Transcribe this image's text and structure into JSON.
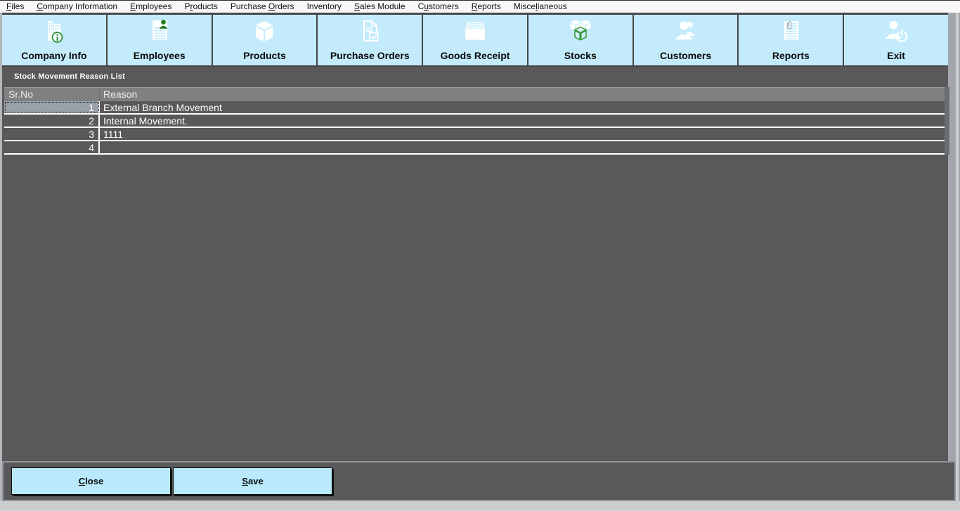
{
  "menu": {
    "items": [
      {
        "label": "Files",
        "underline": 0
      },
      {
        "label": "Company Information",
        "underline": 0
      },
      {
        "label": "Employees",
        "underline": 0
      },
      {
        "label": "Products",
        "underline": 1
      },
      {
        "label": "Purchase Orders",
        "underline": 9
      },
      {
        "label": "Inventory",
        "underline": -1
      },
      {
        "label": "Sales Module",
        "underline": 0
      },
      {
        "label": "Customers",
        "underline": 1
      },
      {
        "label": "Reports",
        "underline": 0
      },
      {
        "label": "Miscellaneous",
        "underline": 5
      }
    ]
  },
  "toolbar": {
    "items": [
      {
        "label": "Company Info",
        "icon": "building-info-icon"
      },
      {
        "label": "Employees",
        "icon": "employee-card-icon"
      },
      {
        "label": "Products",
        "icon": "cube-icon"
      },
      {
        "label": "Purchase Orders",
        "icon": "document-check-icon"
      },
      {
        "label": "Goods Receipt",
        "icon": "goods-box-icon"
      },
      {
        "label": "Stocks",
        "icon": "stacked-cubes-icon"
      },
      {
        "label": "Customers",
        "icon": "people-icon"
      },
      {
        "label": "Reports",
        "icon": "report-document-icon"
      },
      {
        "label": "Exit",
        "icon": "person-power-icon"
      }
    ]
  },
  "panel": {
    "title": "Stock Movement Reason List"
  },
  "table": {
    "columns": [
      "Sr.No",
      "Reason"
    ],
    "rows": [
      {
        "sr": "1",
        "reason": "External Branch Movement",
        "selected": true
      },
      {
        "sr": "2",
        "reason": "Internal Movement.",
        "selected": false
      },
      {
        "sr": "3",
        "reason": "1111",
        "selected": false
      },
      {
        "sr": "4",
        "reason": "",
        "selected": false
      }
    ]
  },
  "footer": {
    "buttons": [
      {
        "label": "Close",
        "underline": 0
      },
      {
        "label": "Save",
        "underline": 0
      }
    ]
  },
  "colors": {
    "toolbar_blue": "#c3ebfb",
    "footer_button_blue": "#b9e9fb",
    "panel_gray": "#595959",
    "grid_header_gray": "#808080",
    "selected_cell_gray": "#9aa1a8",
    "accent_green": "#2f8f2f"
  }
}
